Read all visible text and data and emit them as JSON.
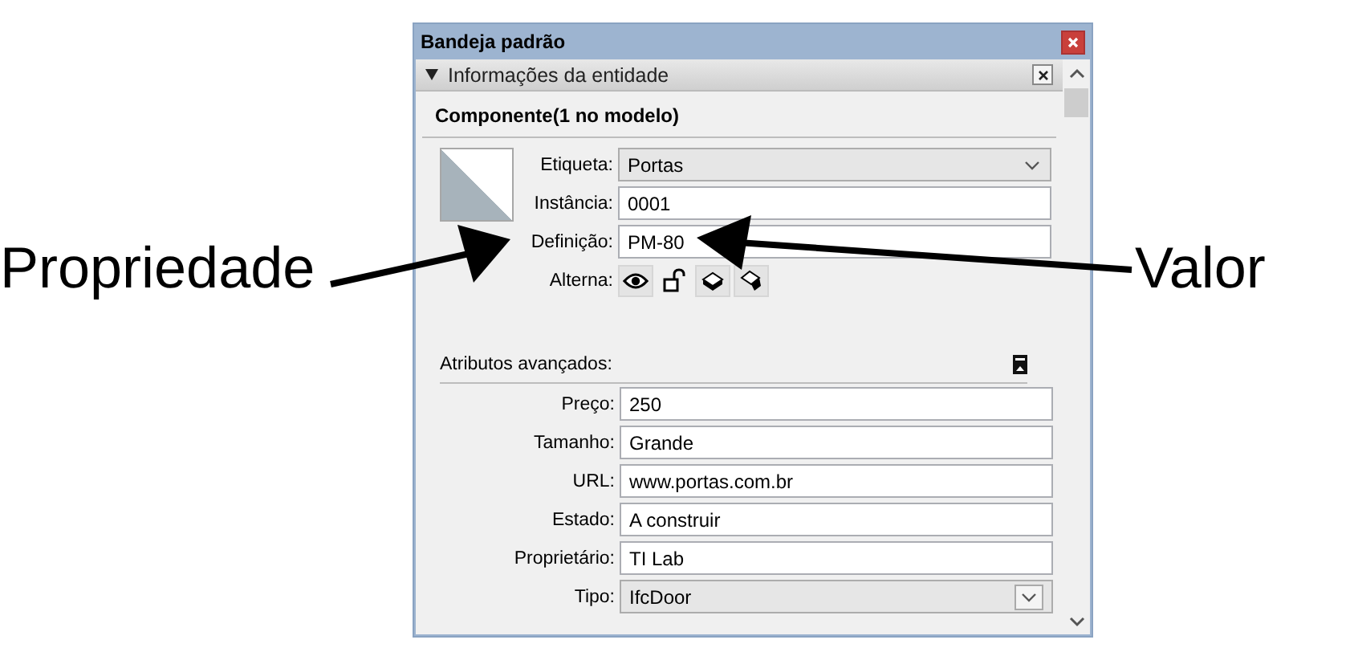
{
  "window": {
    "title": "Bandeja padrão"
  },
  "panel": {
    "title": "Informações da entidade",
    "expanded": true,
    "heading": "Componente(1 no modelo)",
    "fields": [
      {
        "label": "Etiqueta:",
        "kind": "dropdown",
        "value": "Portas"
      },
      {
        "label": "Instância:",
        "kind": "text",
        "value": "0001"
      },
      {
        "label": "Definição:",
        "kind": "text",
        "value": "PM-80"
      }
    ],
    "toggles_label": "Alterna:",
    "toggles": [
      {
        "kind": "eye",
        "on": true
      },
      {
        "kind": "lock",
        "on": false
      },
      {
        "kind": "receive-shadow",
        "on": true
      },
      {
        "kind": "cast-shadow",
        "on": true
      }
    ],
    "advanced": {
      "title": "Atributos avançados:",
      "fields": [
        {
          "label": "Preço:",
          "kind": "text",
          "value": "250"
        },
        {
          "label": "Tamanho:",
          "kind": "text",
          "value": "Grande"
        },
        {
          "label": "URL:",
          "kind": "text",
          "value": "www.portas.com.br"
        },
        {
          "label": "Estado:",
          "kind": "text",
          "value": "A construir"
        },
        {
          "label": "Proprietário:",
          "kind": "text",
          "value": "TI Lab"
        },
        {
          "label": "Tipo:",
          "kind": "combo",
          "value": "IfcDoor"
        }
      ]
    }
  },
  "callouts": {
    "left": "Propriedade",
    "right": "Valor"
  }
}
